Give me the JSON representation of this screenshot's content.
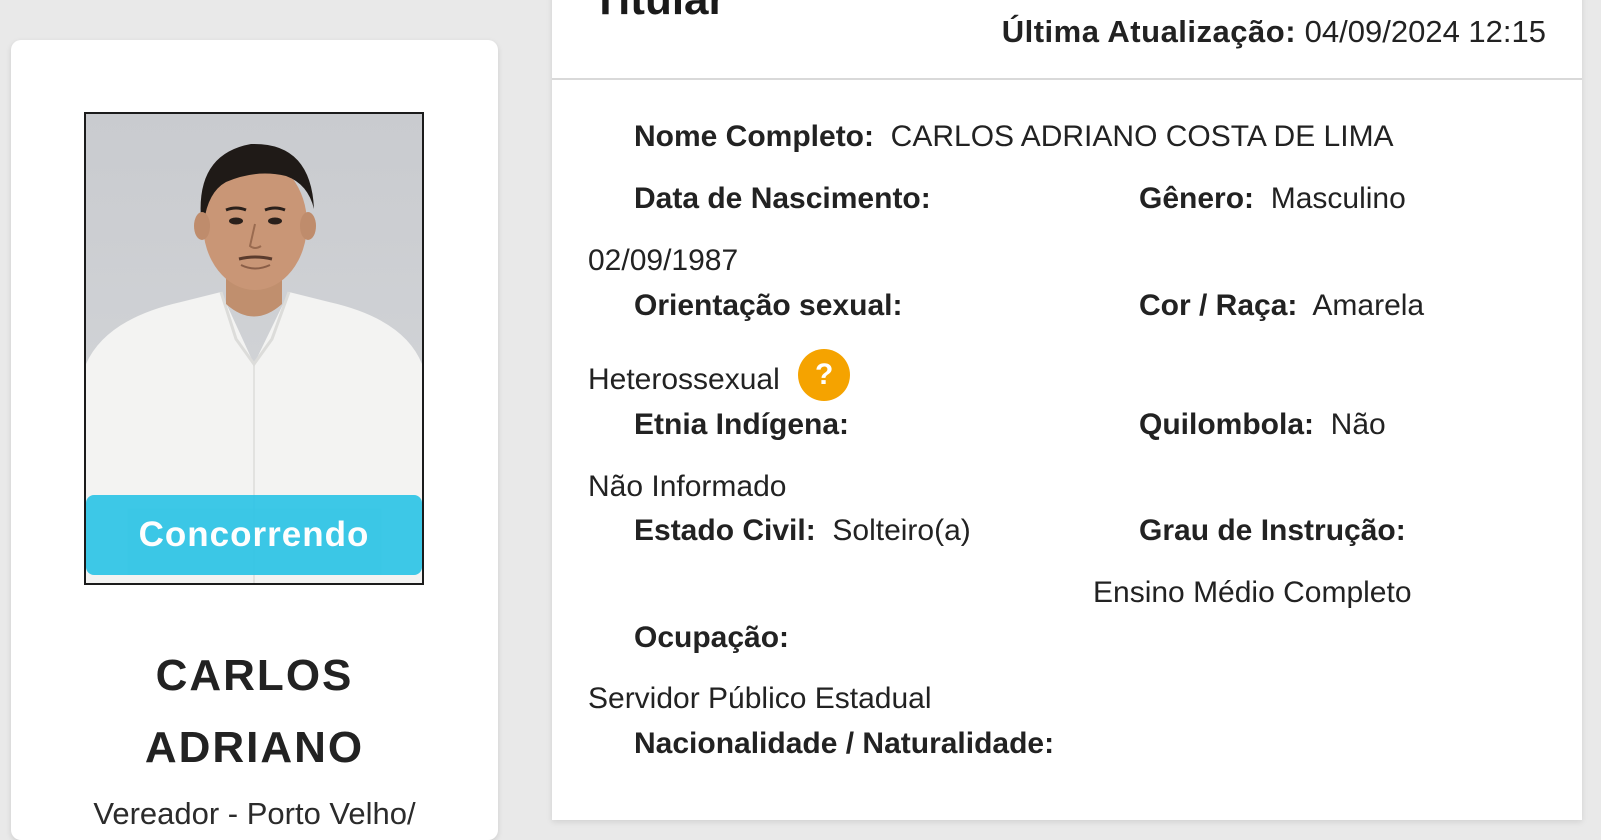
{
  "profile": {
    "status": "Concorrendo",
    "name_line1": "CARLOS",
    "name_line2": "ADRIANO",
    "role": "Vereador - Porto Velho/"
  },
  "panel": {
    "title": "Titular",
    "last_update_label": "Última Atualização:",
    "last_update_value": "04/09/2024 12:15"
  },
  "fields": {
    "nome_label": "Nome Completo:",
    "nome_value": "CARLOS ADRIANO COSTA DE LIMA",
    "nascimento_label": "Data de Nascimento:",
    "nascimento_value": "02/09/1987",
    "genero_label": "Gênero:",
    "genero_value": "Masculino",
    "orientacao_label": "Orientação sexual:",
    "orientacao_value": "Heterossexual",
    "cor_label": "Cor / Raça:",
    "cor_value": "Amarela",
    "etnia_label": "Etnia Indígena:",
    "etnia_value": "Não Informado",
    "quilombola_label": "Quilombola:",
    "quilombola_value": "Não",
    "estado_civil_label": "Estado Civil:",
    "estado_civil_value": "Solteiro(a)",
    "instrucao_label": "Grau de Instrução:",
    "instrucao_value": "Ensino Médio Completo",
    "ocupacao_label": "Ocupação:",
    "ocupacao_value": "Servidor Público Estadual",
    "nacionalidade_label": "Nacionalidade / Naturalidade:"
  },
  "icons": {
    "help": "question-mark",
    "help_color": "#f5a300",
    "status_color": "#2ec4e6"
  }
}
